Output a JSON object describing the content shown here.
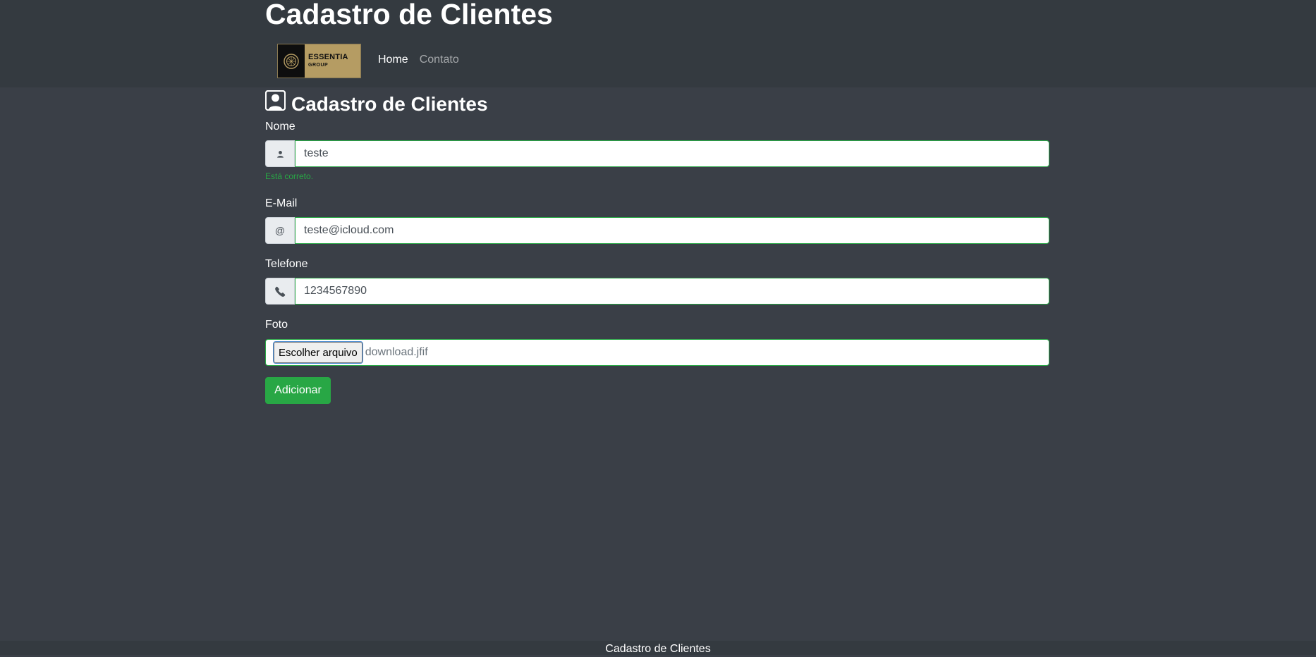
{
  "header": {
    "site_title": "Cadastro de Clientes",
    "logo": {
      "name": "ESSENTIA",
      "sub": "GROUP",
      "colors": {
        "mark_bg": "#0e0e0e",
        "text_bg": "#b59c63"
      }
    },
    "nav": [
      {
        "label": "Home",
        "active": true
      },
      {
        "label": "Contato",
        "active": false
      }
    ]
  },
  "form": {
    "title": "Cadastro de Clientes",
    "title_icon": "person-square-icon",
    "fields": {
      "nome": {
        "label": "Nome",
        "icon": "person-icon",
        "value": "teste",
        "feedback": "Está correto."
      },
      "email": {
        "label": "E-Mail",
        "icon_text": "@",
        "value": "teste@icloud.com"
      },
      "telefone": {
        "label": "Telefone",
        "icon": "phone-icon",
        "value": "1234567890"
      },
      "foto": {
        "label": "Foto",
        "button_label": "Escolher arquivo",
        "file_name": "download.jfif"
      }
    },
    "submit_label": "Adicionar"
  },
  "footer": {
    "text": "Cadastro de Clientes"
  },
  "colors": {
    "page_bg": "#3a3f47",
    "header_bg": "#343a40",
    "success": "#28a745"
  }
}
